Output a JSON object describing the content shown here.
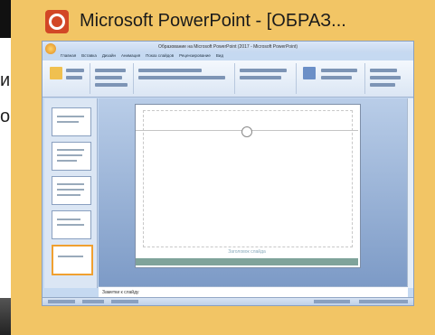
{
  "popup": {
    "title": "Microsoft PowerPoint - [ОБРАЗ...",
    "icon": "powerpoint-icon",
    "accent_color": "#f2c565",
    "icon_color": "#d24726"
  },
  "background": {
    "fragment_1": "и",
    "fragment_2": "о"
  },
  "thumbnail": {
    "window_title": "Образование на Microsoft PowerPoint (2017 - Microsoft PowerPoint)",
    "ribbon_tabs": [
      "Главная",
      "Вставка",
      "Дизайн",
      "Анимация",
      "Показ слайдов",
      "Рецензирование",
      "Вид"
    ],
    "notes_placeholder": "Заметки к слайду",
    "slide_caption": "Заголовок слайда"
  }
}
